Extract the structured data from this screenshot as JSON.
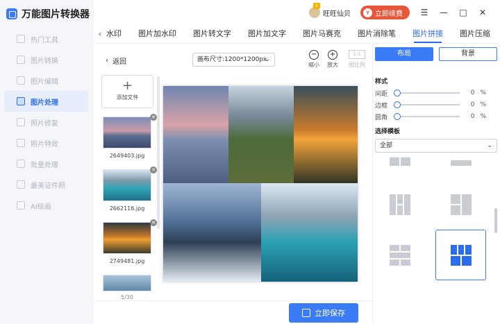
{
  "app": {
    "title": "万能图片转换器"
  },
  "sidebar": {
    "items": [
      {
        "label": "热门工具",
        "active": false
      },
      {
        "label": "图片转换",
        "active": false
      },
      {
        "label": "图片编辑",
        "active": false
      },
      {
        "label": "图片处理",
        "active": true
      },
      {
        "label": "照片修复",
        "active": false
      },
      {
        "label": "照片特效",
        "active": false
      },
      {
        "label": "批量处理",
        "active": false
      },
      {
        "label": "最美证件照",
        "active": false
      },
      {
        "label": "AI绘画",
        "active": false
      }
    ]
  },
  "header": {
    "user_name": "旺旺仙贝",
    "vip_badge": "V",
    "renew_label": "立即续费",
    "renew_icon": "¥"
  },
  "tabs": {
    "items": [
      "水印",
      "图片加水印",
      "图片转文字",
      "图片加文字",
      "图片马赛克",
      "图片消除笔",
      "图片拼接",
      "图片压缩"
    ],
    "active_index": 6
  },
  "toolbar": {
    "back_label": "返回",
    "canvas_size": "画布尺寸:1200*1200px",
    "zoom_out_label": "缩小",
    "zoom_in_label": "放大",
    "ratio_box": "1:1",
    "ratio_label": "图比例"
  },
  "files": {
    "add_label": "添加文件",
    "items": [
      {
        "name": "2649403.jpg"
      },
      {
        "name": "2662116.jpg"
      },
      {
        "name": "2749481.jpg"
      }
    ],
    "count": "5/30"
  },
  "actions": {
    "save_label": "立即保存"
  },
  "right_panel": {
    "layout_label": "布局",
    "background_label": "背景",
    "style_title": "样式",
    "sliders": [
      {
        "label": "间距",
        "value": "0",
        "unit": "%"
      },
      {
        "label": "边框",
        "value": "0",
        "unit": "%"
      },
      {
        "label": "圆角",
        "value": "0",
        "unit": "%"
      }
    ],
    "template_title": "选择模板",
    "template_filter": "全部"
  }
}
